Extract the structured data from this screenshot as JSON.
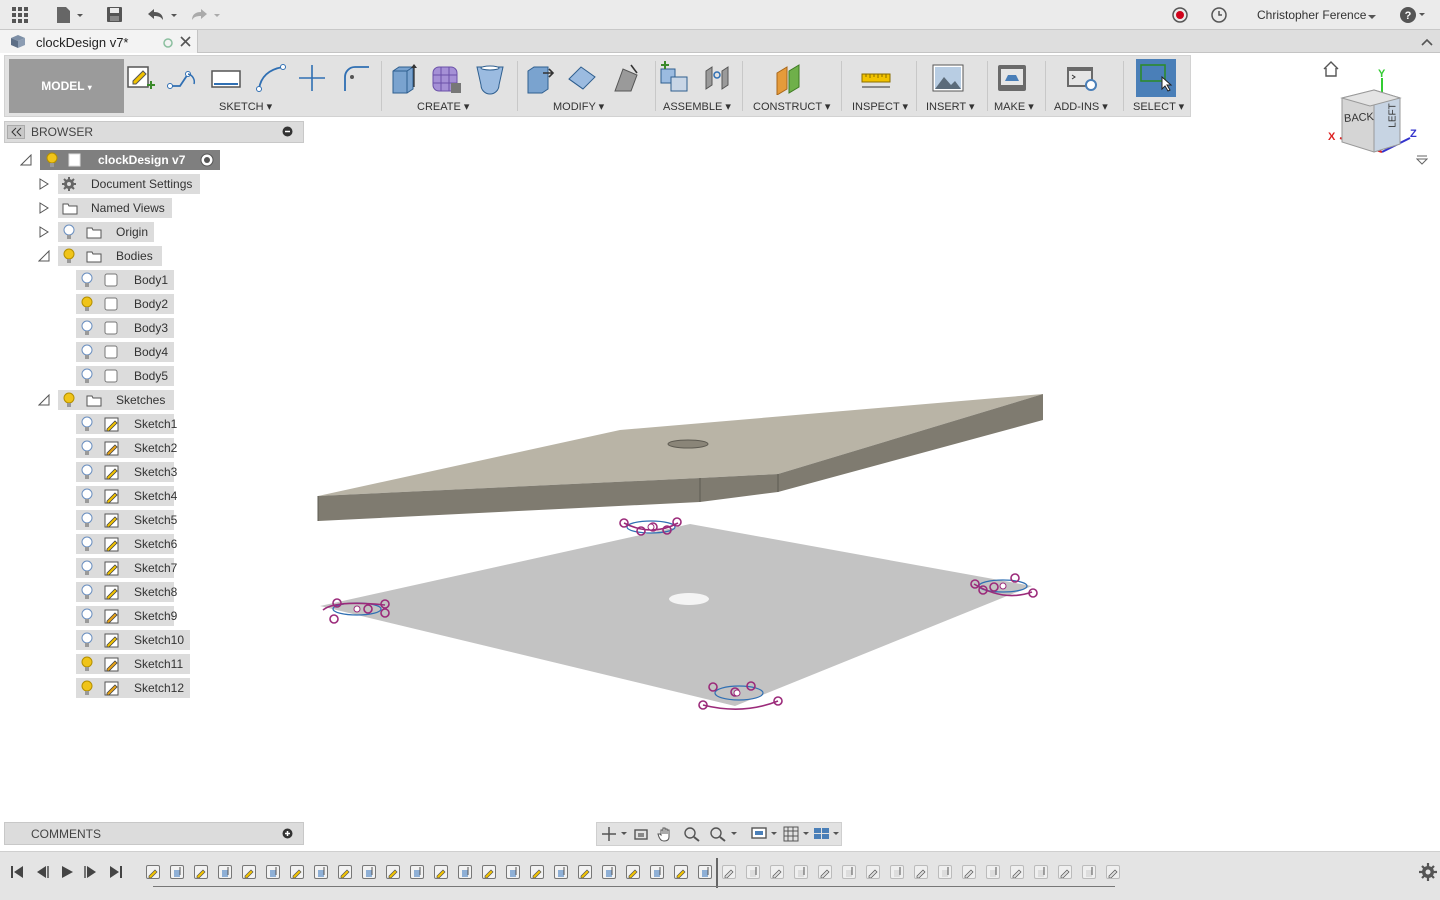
{
  "titlebar": {
    "user": "Christopher Ference"
  },
  "document": {
    "tab_title": "clockDesign v7*"
  },
  "toolbar": {
    "workspace": "MODEL",
    "groups": {
      "sketch": "SKETCH",
      "create": "CREATE",
      "modify": "MODIFY",
      "assemble": "ASSEMBLE",
      "construct": "CONSTRUCT",
      "inspect": "INSPECT",
      "insert": "INSERT",
      "make": "MAKE",
      "addins": "ADD-INS",
      "select": "SELECT"
    }
  },
  "viewcube": {
    "back": "BACK",
    "left": "LEFT",
    "x": "X",
    "y": "Y",
    "z": "Z"
  },
  "browser": {
    "title": "BROWSER",
    "root": "clockDesign v7",
    "folders": {
      "doc_settings": "Document Settings",
      "named_views": "Named Views",
      "origin": "Origin",
      "bodies": "Bodies",
      "sketches": "Sketches"
    },
    "bodies": [
      "Body1",
      "Body2",
      "Body3",
      "Body4",
      "Body5"
    ],
    "sketches": [
      "Sketch1",
      "Sketch2",
      "Sketch3",
      "Sketch4",
      "Sketch5",
      "Sketch6",
      "Sketch7",
      "Sketch8",
      "Sketch9",
      "Sketch10",
      "Sketch11",
      "Sketch12"
    ]
  },
  "comments": {
    "title": "COMMENTS"
  },
  "colors": {
    "accent": "#2f6fb3",
    "select_active": "#4a7fb8",
    "sketch_constraint": "#9b2a7a",
    "bulb_on": "#f0c419"
  }
}
